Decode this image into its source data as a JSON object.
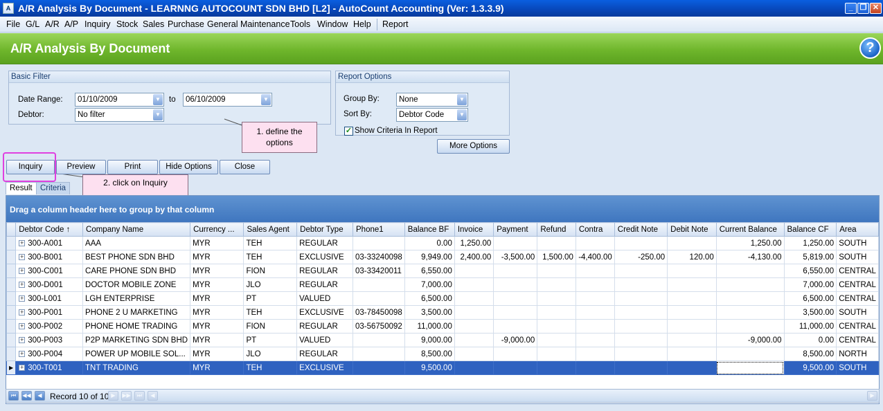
{
  "window": {
    "title": "A/R Analysis By Document - LEARNNG AUTOCOUNT SDN BHD [L2] - AutoCount Accounting (Ver: 1.3.3.9)"
  },
  "menu": {
    "file": "File",
    "gl": "G/L",
    "ar": "A/R",
    "ap": "A/P",
    "inquiry": "Inquiry",
    "stock": "Stock",
    "sales": "Sales",
    "purchase": "Purchase",
    "general_maintenance": "General Maintenance",
    "tools": "Tools",
    "window": "Window",
    "help": "Help",
    "report": "Report"
  },
  "page_title": "A/R Analysis By Document",
  "basic_filter": {
    "title": "Basic Filter",
    "date_range_label": "Date Range:",
    "date_from": "01/10/2009",
    "to_label": "to",
    "date_to": "06/10/2009",
    "debtor_label": "Debtor:",
    "debtor_value": "No filter"
  },
  "report_options": {
    "title": "Report Options",
    "group_by_label": "Group By:",
    "group_by_value": "None",
    "sort_by_label": "Sort By:",
    "sort_by_value": "Debtor Code",
    "show_criteria_label": "Show Criteria In Report",
    "show_criteria_checked": true,
    "more_options": "More Options"
  },
  "notes": {
    "note1": "1. define the options",
    "note2": "2. click on Inquiry"
  },
  "buttons": {
    "inquiry": "Inquiry",
    "preview": "Preview",
    "print": "Print",
    "hide_options": "Hide Options",
    "close": "Close"
  },
  "tabs": {
    "result": "Result",
    "criteria": "Criteria"
  },
  "grid": {
    "group_panel": "Drag a column header here to group by that column",
    "columns": [
      "Debtor Code",
      "Company Name",
      "Currency ...",
      "Sales Agent",
      "Debtor Type",
      "Phone1",
      "Balance BF",
      "Invoice",
      "Payment",
      "Refund",
      "Contra",
      "Credit Note",
      "Debit Note",
      "Current Balance",
      "Balance CF",
      "Area"
    ],
    "sort_indicator": "↑",
    "rows": [
      [
        "300-A001",
        "AAA",
        "MYR",
        "TEH",
        "REGULAR",
        "",
        "0.00",
        "1,250.00",
        "",
        "",
        "",
        "",
        "",
        "1,250.00",
        "1,250.00",
        "SOUTH"
      ],
      [
        "300-B001",
        "BEST PHONE SDN BHD",
        "MYR",
        "TEH",
        "EXCLUSIVE",
        "03-33240098",
        "9,949.00",
        "2,400.00",
        "-3,500.00",
        "1,500.00",
        "-4,400.00",
        "-250.00",
        "120.00",
        "-4,130.00",
        "5,819.00",
        "SOUTH"
      ],
      [
        "300-C001",
        "CARE PHONE SDN BHD",
        "MYR",
        "FION",
        "REGULAR",
        "03-33420011",
        "6,550.00",
        "",
        "",
        "",
        "",
        "",
        "",
        "",
        "6,550.00",
        "CENTRAL"
      ],
      [
        "300-D001",
        "DOCTOR MOBILE ZONE",
        "MYR",
        "JLO",
        "REGULAR",
        "",
        "7,000.00",
        "",
        "",
        "",
        "",
        "",
        "",
        "",
        "7,000.00",
        "CENTRAL"
      ],
      [
        "300-L001",
        "LGH ENTERPRISE",
        "MYR",
        "PT",
        "VALUED",
        "",
        "6,500.00",
        "",
        "",
        "",
        "",
        "",
        "",
        "",
        "6,500.00",
        "CENTRAL"
      ],
      [
        "300-P001",
        "PHONE 2 U MARKETING",
        "MYR",
        "TEH",
        "EXCLUSIVE",
        "03-78450098",
        "3,500.00",
        "",
        "",
        "",
        "",
        "",
        "",
        "",
        "3,500.00",
        "SOUTH"
      ],
      [
        "300-P002",
        "PHONE HOME TRADING",
        "MYR",
        "FION",
        "REGULAR",
        "03-56750092",
        "11,000.00",
        "",
        "",
        "",
        "",
        "",
        "",
        "",
        "11,000.00",
        "CENTRAL"
      ],
      [
        "300-P003",
        "P2P MARKETING SDN BHD",
        "MYR",
        "PT",
        "VALUED",
        "",
        "9,000.00",
        "",
        "-9,000.00",
        "",
        "",
        "",
        "",
        "-9,000.00",
        "0.00",
        "CENTRAL"
      ],
      [
        "300-P004",
        "POWER UP MOBILE SOL...",
        "MYR",
        "JLO",
        "REGULAR",
        "",
        "8,500.00",
        "",
        "",
        "",
        "",
        "",
        "",
        "",
        "8,500.00",
        "NORTH"
      ],
      [
        "300-T001",
        "TNT TRADING",
        "MYR",
        "TEH",
        "EXCLUSIVE",
        "",
        "9,500.00",
        "",
        "",
        "",
        "",
        "",
        "",
        "",
        "9,500.00",
        "SOUTH"
      ]
    ],
    "selected_row": 9
  },
  "navigator": {
    "record_text": "Record 10 of 10"
  },
  "colors": {
    "header_green": "#6fb62c",
    "selection_blue": "#2f62c0",
    "annotation_magenta": "#e040e0",
    "note_pink": "#fde0f0"
  }
}
